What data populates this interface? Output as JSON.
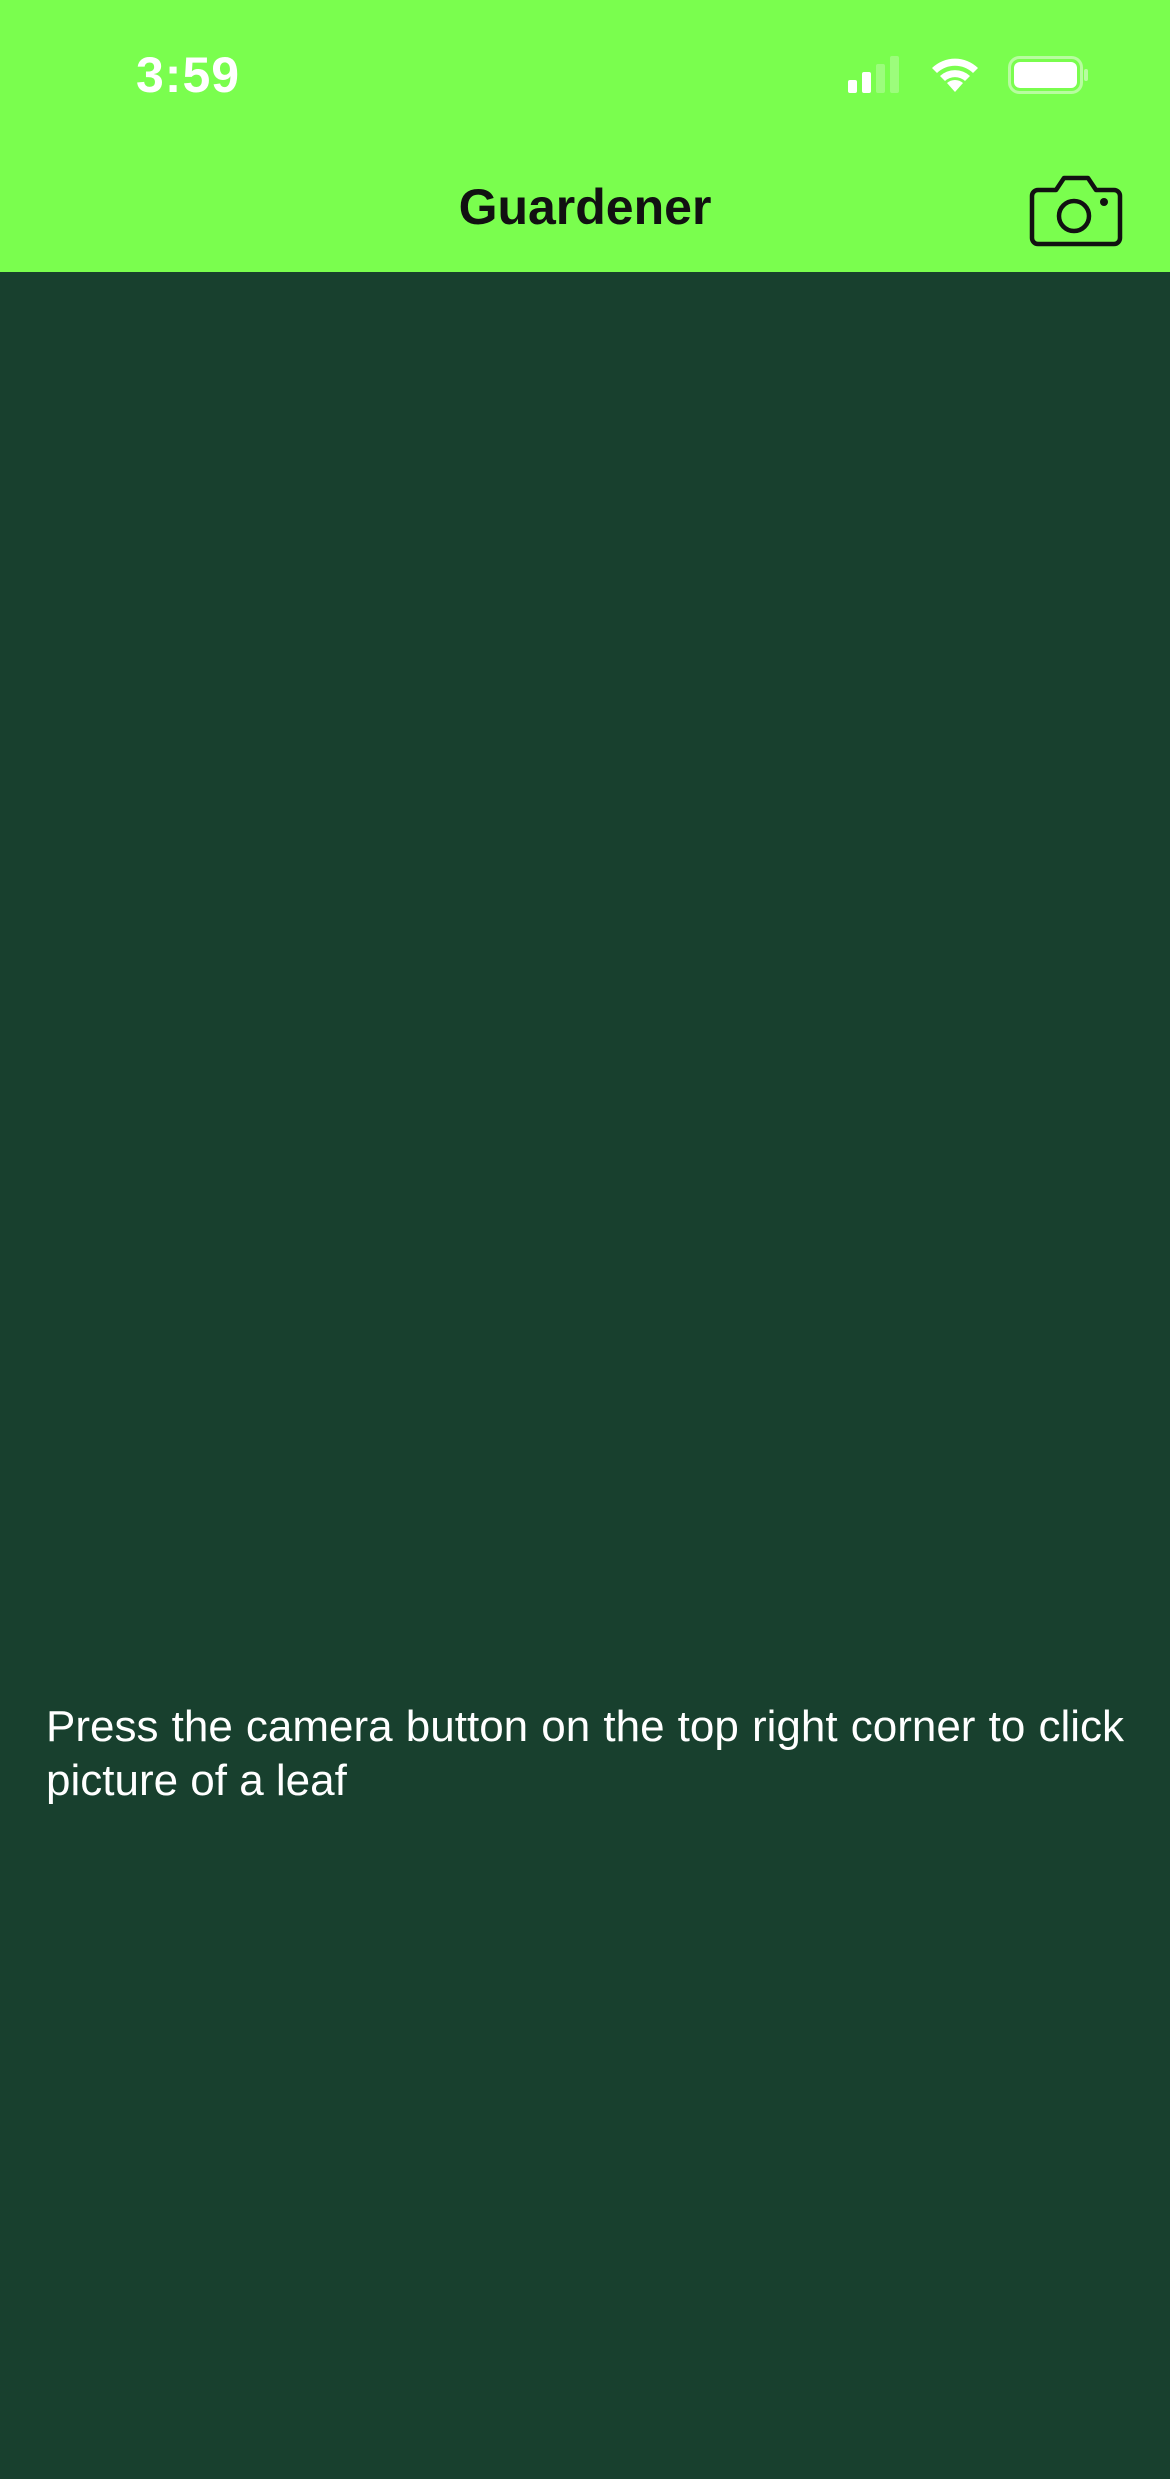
{
  "status_bar": {
    "time": "3:59",
    "signal_icon": "cellular-signal-icon",
    "wifi_icon": "wifi-icon",
    "battery_icon": "battery-icon",
    "battery_level": 1.0
  },
  "nav_bar": {
    "title": "Guardener",
    "camera_icon": "camera-icon"
  },
  "main": {
    "message": "Press the camera button on the top right corner to click picture of a leaf"
  },
  "colors": {
    "header_background": "#7afe4e",
    "content_background": "#18402e",
    "title_text": "#111111",
    "body_text": "#ffffff"
  }
}
